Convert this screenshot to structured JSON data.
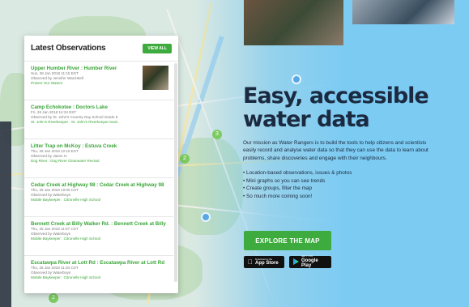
{
  "panel": {
    "title": "Latest Observations",
    "view_all": "VIEW ALL",
    "items": [
      {
        "title": "Upper Humber River : Humber River",
        "date": "Sun, 28 Jan 2018 11:15 EST",
        "observer": "Observed by Jennifer Ward-Bell",
        "group": "Protect Our Waters",
        "has_photo": true
      },
      {
        "title": "Camp Echokotee : Doctors Lake",
        "date": "Fri, 26 Jan 2018 14:34 EST",
        "observer": "Observed by St. John's Country Day School Grade 8",
        "group": "St. John's Riverkeeper : St. John's Riverkeeper team"
      },
      {
        "title": "Litter Trap on McKoy : Estuva Creek",
        "date": "Thu, 25 Jan 2018 12:15 EST",
        "observer": "Observed by Jason H.",
        "group": "Dog River : Dog River Clearwater Revival"
      },
      {
        "title": "Cedar Creek at Highway 98 : Cedar Creek at Highway 98",
        "date": "Thu, 25 Jan 2018 10:00 CST",
        "observer": "Observed by Waterboys",
        "group": "Mobile Baykeeper : Citronelle High School"
      },
      {
        "title": "Bennett Creek at Billy Walker Rd. : Bennett Creek at Billy Walker Rd.",
        "date": "Thu, 25 Jan 2018 11:57 CST",
        "observer": "Observed by Waterboys",
        "group": "Mobile Baykeeper : Citronelle High School"
      },
      {
        "title": "Escatawpa River at Lott Rd : Escatawpa River at Lott Rd",
        "date": "Thu, 25 Jan 2018 11:34 CST",
        "observer": "Observed by Waterboys",
        "group": "Mobile Baykeeper : Citronelle High School"
      }
    ]
  },
  "hero": {
    "title_line1": "Easy, accessible",
    "title_line2": "water data",
    "description": "Our mission as Water Rangers is to build the tools to help citizens and scientists easily record and analyse water data so that they can use the data to learn about problems, share discoveries and engage with their neighbours.",
    "bullets": [
      "• Location-based observations, issues & photos",
      "• Mini graphs so you can see trends",
      "• Create groups, filter the map",
      "• So much more coming soon!"
    ],
    "cta": "EXPLORE THE MAP"
  },
  "stores": {
    "apple_small": "Download on the",
    "apple_big": "App Store",
    "google_small": "GET IT ON",
    "google_big": "Google Play"
  },
  "map": {
    "cluster_labels": [
      "3",
      "2",
      "2"
    ]
  }
}
